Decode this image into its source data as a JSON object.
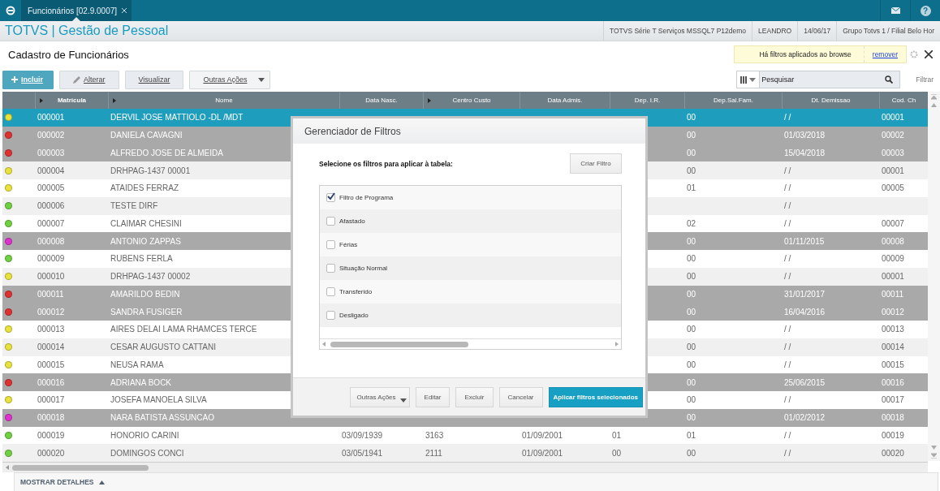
{
  "topbar": {
    "tab": {
      "label": "Funcionários [02.9.0007]",
      "selected": true
    },
    "help_glyph": "?"
  },
  "header": {
    "title": "TOTVS | Gestão de Pessoal",
    "info": [
      "TOTVS Série T Serviços MSSQL7 P12demo",
      "LEANDRO",
      "14/06/17",
      "Grupo Totvs 1 / Filial Belo Hor"
    ]
  },
  "page_title": "Cadastro de Funcionários",
  "filter_notice": {
    "text": "Há filtros aplicados ao browse",
    "link": "remover"
  },
  "toolbar": [
    {
      "label": "Incluir",
      "kind": "primary"
    },
    {
      "label": "Alterar",
      "kind": "edit"
    },
    {
      "label": "Visualizar",
      "kind": "normal"
    },
    {
      "label": "Outras Ações",
      "kind": "menu"
    }
  ],
  "search": {
    "placeholder": "Pesquisar",
    "filter_link": "Filtrar"
  },
  "table": {
    "columns": [
      {
        "label": "Matrícula",
        "marker": true
      },
      {
        "label": "Nome",
        "marker": true
      },
      {
        "label": "Data Nasc.",
        "marker": false
      },
      {
        "label": "Centro Custo",
        "marker": true
      },
      {
        "label": "Data Admis.",
        "marker": false
      },
      {
        "label": "Dep. I.R.",
        "marker": false
      },
      {
        "label": "Dep.Sal.Fam.",
        "marker": false
      },
      {
        "label": "Dt. Demissao",
        "marker": false
      },
      {
        "label": "Cod. Ch",
        "marker": false
      }
    ],
    "rows": [
      {
        "color": "#e8e23a",
        "selected": true,
        "dismissed": false,
        "cells": [
          "000001",
          "DERVIL JOSE MATTIOLO -DL /MDT",
          null,
          null,
          null,
          null,
          "00",
          "/ /",
          "00001"
        ]
      },
      {
        "color": "#e03030",
        "selected": false,
        "dismissed": true,
        "cells": [
          "000002",
          "DANIELA CAVAGNI",
          null,
          null,
          null,
          null,
          "00",
          "01/03/2018",
          "00002"
        ]
      },
      {
        "color": "#e03030",
        "selected": false,
        "dismissed": true,
        "cells": [
          "000003",
          "ALFREDO JOSE DE ALMEIDA",
          null,
          null,
          null,
          null,
          "00",
          "15/04/2018",
          "00003"
        ]
      },
      {
        "color": "#e8e23a",
        "selected": false,
        "dismissed": false,
        "cells": [
          "000004",
          "DRHPAG-1437 00001",
          null,
          null,
          null,
          null,
          "00",
          "/ /",
          "00001"
        ]
      },
      {
        "color": "#e8e23a",
        "selected": false,
        "dismissed": false,
        "cells": [
          "000005",
          "ATAIDES FERRAZ",
          null,
          null,
          null,
          null,
          "01",
          "/ /",
          "00005"
        ]
      },
      {
        "color": "#6fd040",
        "selected": false,
        "dismissed": false,
        "cells": [
          "000006",
          "TESTE DIRF",
          null,
          null,
          null,
          null,
          null,
          "/ /",
          null
        ]
      },
      {
        "color": "#6fd040",
        "selected": false,
        "dismissed": false,
        "cells": [
          "000007",
          "CLAIMAR CHESINI",
          null,
          null,
          null,
          null,
          "02",
          "/ /",
          "00007"
        ]
      },
      {
        "color": "#e030d0",
        "selected": false,
        "dismissed": true,
        "cells": [
          "000008",
          "ANTONIO ZAPPAS",
          null,
          null,
          null,
          null,
          "00",
          "01/11/2015",
          "00008"
        ]
      },
      {
        "color": "#6fd040",
        "selected": false,
        "dismissed": false,
        "cells": [
          "000009",
          "RUBENS FERLA",
          null,
          null,
          null,
          null,
          "00",
          "/ /",
          "00009"
        ]
      },
      {
        "color": "#e8e23a",
        "selected": false,
        "dismissed": false,
        "cells": [
          "000010",
          "DRHPAG-1437 00002",
          null,
          null,
          null,
          null,
          "00",
          "/ /",
          "00001"
        ]
      },
      {
        "color": "#e03030",
        "selected": false,
        "dismissed": true,
        "cells": [
          "000011",
          "AMARILDO BEDIN",
          null,
          null,
          null,
          null,
          "00",
          "31/01/2017",
          "00011"
        ]
      },
      {
        "color": "#e03030",
        "selected": false,
        "dismissed": true,
        "cells": [
          "000012",
          "SANDRA FUSIGER",
          null,
          null,
          null,
          null,
          "00",
          "16/04/2016",
          "00012"
        ]
      },
      {
        "color": "#e8e23a",
        "selected": false,
        "dismissed": false,
        "cells": [
          "000013",
          "AIRES DELAI LAMA RHAMCES TERCE",
          null,
          null,
          null,
          null,
          "00",
          "/ /",
          "00013"
        ]
      },
      {
        "color": "#e8e23a",
        "selected": false,
        "dismissed": false,
        "cells": [
          "000014",
          "CESAR AUGUSTO CATTANI",
          null,
          null,
          null,
          null,
          "00",
          "/ /",
          "00014"
        ]
      },
      {
        "color": "#e8e23a",
        "selected": false,
        "dismissed": false,
        "cells": [
          "000015",
          "NEUSA RAMA",
          null,
          null,
          null,
          null,
          "00",
          "/ /",
          "00015"
        ]
      },
      {
        "color": "#e03030",
        "selected": false,
        "dismissed": true,
        "cells": [
          "000016",
          "ADRIANA BOCK",
          null,
          null,
          null,
          null,
          "00",
          "25/06/2015",
          "00016"
        ]
      },
      {
        "color": "#e8e23a",
        "selected": false,
        "dismissed": false,
        "cells": [
          "000017",
          "JOSEFA MANOELA SILVA",
          null,
          null,
          null,
          null,
          "00",
          "/ /",
          "00017"
        ]
      },
      {
        "color": "#e030d0",
        "selected": false,
        "dismissed": true,
        "cells": [
          "000018",
          "NARA BATISTA ASSUNCAO",
          null,
          null,
          null,
          null,
          "00",
          "01/02/2012",
          "00018"
        ]
      },
      {
        "color": "#6fd040",
        "selected": false,
        "dismissed": false,
        "cells": [
          "000019",
          "HONORIO CARINI",
          "03/09/1939",
          "3163",
          "01/09/2001",
          "01",
          "01",
          "/ /",
          "00019"
        ]
      },
      {
        "color": "#6fd040",
        "selected": false,
        "dismissed": false,
        "cells": [
          "000020",
          "DOMINGOS CONCI",
          "03/05/1941",
          "2111",
          "01/09/2001",
          "00",
          "00",
          "/ /",
          "00020"
        ]
      }
    ]
  },
  "details_toggle": {
    "label": "MOSTRAR DETALHES",
    "expanded": false
  },
  "dialog": {
    "title": "Gerenciador de Filtros",
    "prompt": "Selecione os filtros para aplicar à tabela:",
    "create_button": "Criar Filtro",
    "filters": [
      {
        "label": "Filtro de Programa",
        "checked": true
      },
      {
        "label": "Afastado",
        "checked": false
      },
      {
        "label": "Férias",
        "checked": false
      },
      {
        "label": "Situação Normal",
        "checked": false
      },
      {
        "label": "Transferido",
        "checked": false
      },
      {
        "label": "Desligado",
        "checked": false
      }
    ],
    "buttons": [
      {
        "label": "Outras Ações",
        "kind": "menu"
      },
      {
        "label": "Editar",
        "kind": "normal"
      },
      {
        "label": "Excluir",
        "kind": "normal"
      },
      {
        "label": "Cancelar",
        "kind": "normal"
      },
      {
        "label": "Aplicar filtros selecionados",
        "kind": "primary"
      }
    ]
  }
}
